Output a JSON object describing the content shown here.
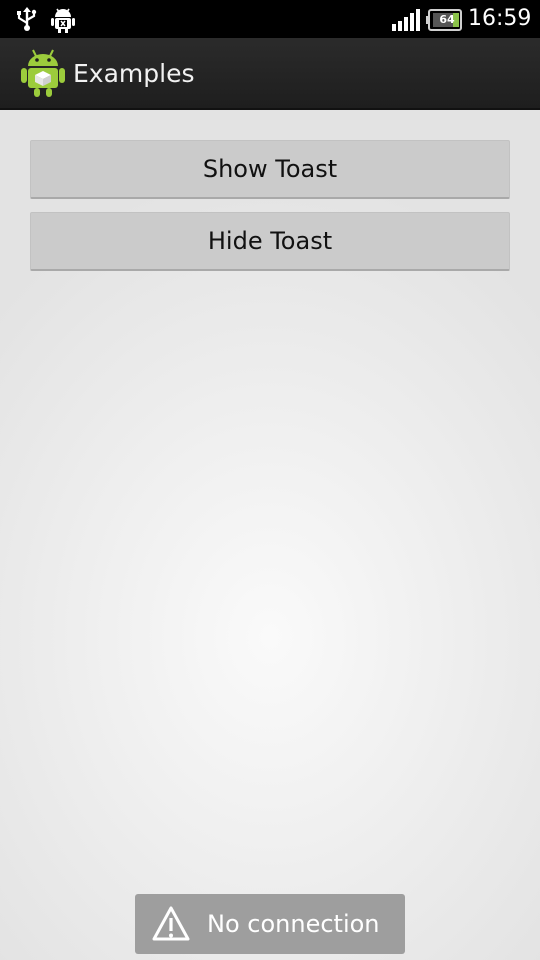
{
  "status_bar": {
    "icons": [
      "usb-icon",
      "android-debug-icon",
      "signal-icon",
      "battery-icon"
    ],
    "battery_level": "64",
    "time": "16:59"
  },
  "action_bar": {
    "icon": "android-app-icon",
    "title": "Examples"
  },
  "buttons": {
    "show_toast": "Show Toast",
    "hide_toast": "Hide Toast"
  },
  "toast": {
    "icon": "warning-icon",
    "message": "No connection"
  },
  "colors": {
    "action_bar": "#222222",
    "background": "#e6e6e6",
    "button": "#cbcbcb",
    "toast": "#9e9e9e",
    "android_green": "#9ccc3c"
  }
}
